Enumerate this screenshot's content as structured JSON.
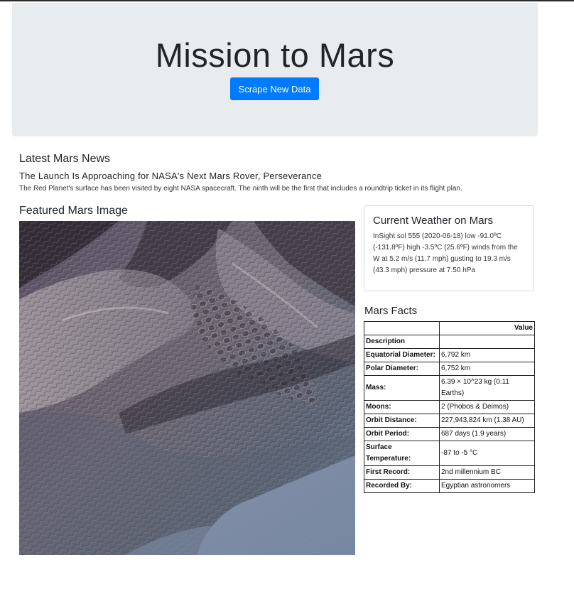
{
  "jumbotron": {
    "title": "Mission to Mars",
    "scrape_button": "Scrape New Data"
  },
  "news": {
    "section_title": "Latest Mars News",
    "headline": "The Launch Is Approaching for NASA's Next Mars Rover, Perseverance",
    "teaser": "The Red Planet's surface has been visited by eight NASA spacecraft. The ninth will be the first that includes a roundtrip ticket in its flight plan."
  },
  "featured": {
    "title": "Featured Mars Image",
    "image_description": "Aerial view of Martian sand dunes"
  },
  "weather": {
    "title": "Current Weather on Mars",
    "text": "InSight sol 555 (2020-06-18) low -91.0ºC (-131.8ºF) high -3.5ºC (25.6ºF) winds from the W at 5.2 m/s (11.7 mph) gusting to 19.3 m/s (43.3 mph) pressure at 7.50 hPa"
  },
  "facts": {
    "title": "Mars Facts",
    "header_empty": "",
    "header_value": "Value",
    "index_label": "Description",
    "rows": [
      {
        "key": "Equatorial Diameter:",
        "value": "6,792 km"
      },
      {
        "key": "Polar Diameter:",
        "value": "6,752 km"
      },
      {
        "key": "Mass:",
        "value": "6.39 × 10^23 kg (0.11 Earths)"
      },
      {
        "key": "Moons:",
        "value": "2 (Phobos & Deimos)"
      },
      {
        "key": "Orbit Distance:",
        "value": "227,943,824 km (1.38 AU)"
      },
      {
        "key": "Orbit Period:",
        "value": "687 days (1.9 years)"
      },
      {
        "key": "Surface Temperature:",
        "value": "-87 to -5 °C"
      },
      {
        "key": "First Record:",
        "value": "2nd millennium BC"
      },
      {
        "key": "Recorded By:",
        "value": "Egyptian astronomers"
      }
    ]
  }
}
